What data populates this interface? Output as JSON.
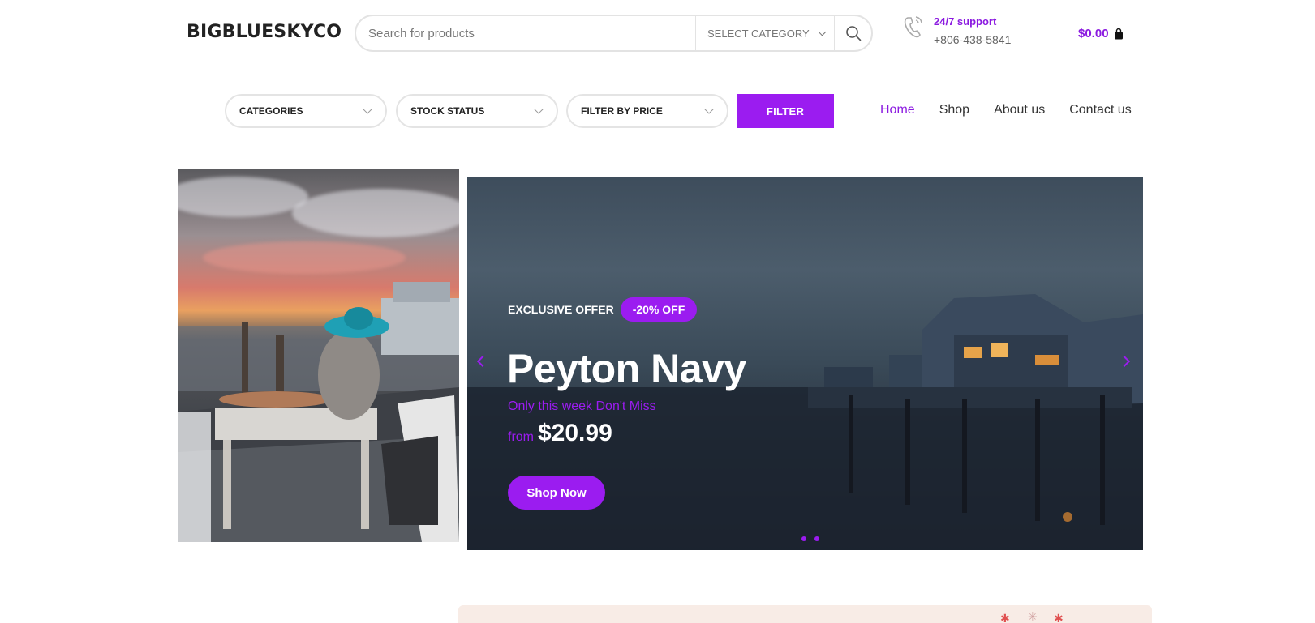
{
  "header": {
    "logo": "BIGBLUESKYCO",
    "search_placeholder": "Search for products",
    "category_select": "SELECT CATEGORY",
    "support_label": "24/7 support",
    "support_phone": "+806-438-5841",
    "cart_total": "$0.00",
    "icons": [
      "search-icon",
      "phone-icon",
      "shopping-bag-icon"
    ]
  },
  "filters": {
    "categories": "CATEGORIES",
    "stock_status": "STOCK STATUS",
    "filter_by_price": "FILTER BY PRICE",
    "filter_button": "FILTER"
  },
  "nav": {
    "items": [
      {
        "label": "Home",
        "active": true
      },
      {
        "label": "Shop",
        "active": false
      },
      {
        "label": "About us",
        "active": false
      },
      {
        "label": "Contact us",
        "active": false
      }
    ]
  },
  "slider": {
    "offer_label": "EXCLUSIVE OFFER",
    "offer_badge": "-20% OFF",
    "title": "Peyton Navy",
    "subtitle": "Only this week Don't Miss",
    "price_prefix": "from",
    "price": "$20.99",
    "cta": "Shop Now",
    "slide_count": 2,
    "active_slide": 1
  },
  "colors": {
    "accent": "#9b1cf0",
    "text": "#333333",
    "border": "#e3e3e3",
    "promo_bg": "#f8ece6"
  }
}
